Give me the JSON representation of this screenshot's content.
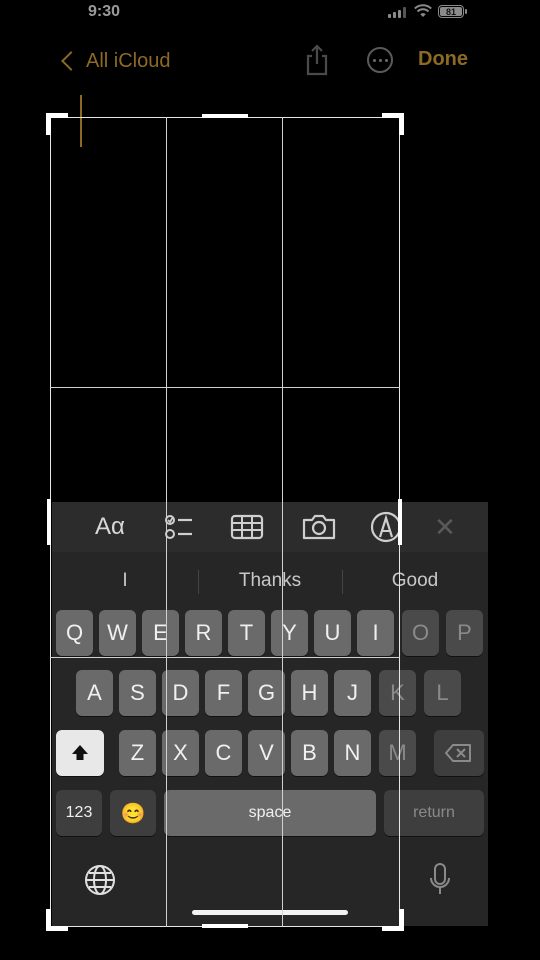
{
  "status_bar": {
    "time": "9:30",
    "battery": "81"
  },
  "nav": {
    "back_label": "All iCloud",
    "done_label": "Done"
  },
  "keyboard": {
    "toolbar": {
      "format_label": "Aα",
      "icons": [
        "format-icon",
        "checklist-icon",
        "table-icon",
        "camera-icon",
        "markup-icon",
        "close-icon"
      ]
    },
    "suggestions": [
      "I",
      "Thanks",
      "Good"
    ],
    "rows": [
      [
        "Q",
        "W",
        "E",
        "R",
        "T",
        "Y",
        "U",
        "I",
        "O",
        "P"
      ],
      [
        "A",
        "S",
        "D",
        "F",
        "G",
        "H",
        "J",
        "K",
        "L"
      ],
      [
        "Z",
        "X",
        "C",
        "V",
        "B",
        "N",
        "M"
      ]
    ],
    "numbers_label": "123",
    "emoji_label": "😊",
    "space_label": "space",
    "return_label": "return"
  },
  "colors": {
    "accent": "#8c6a23",
    "key": "#6a6a6a",
    "keyboard_bg": "#262626"
  }
}
